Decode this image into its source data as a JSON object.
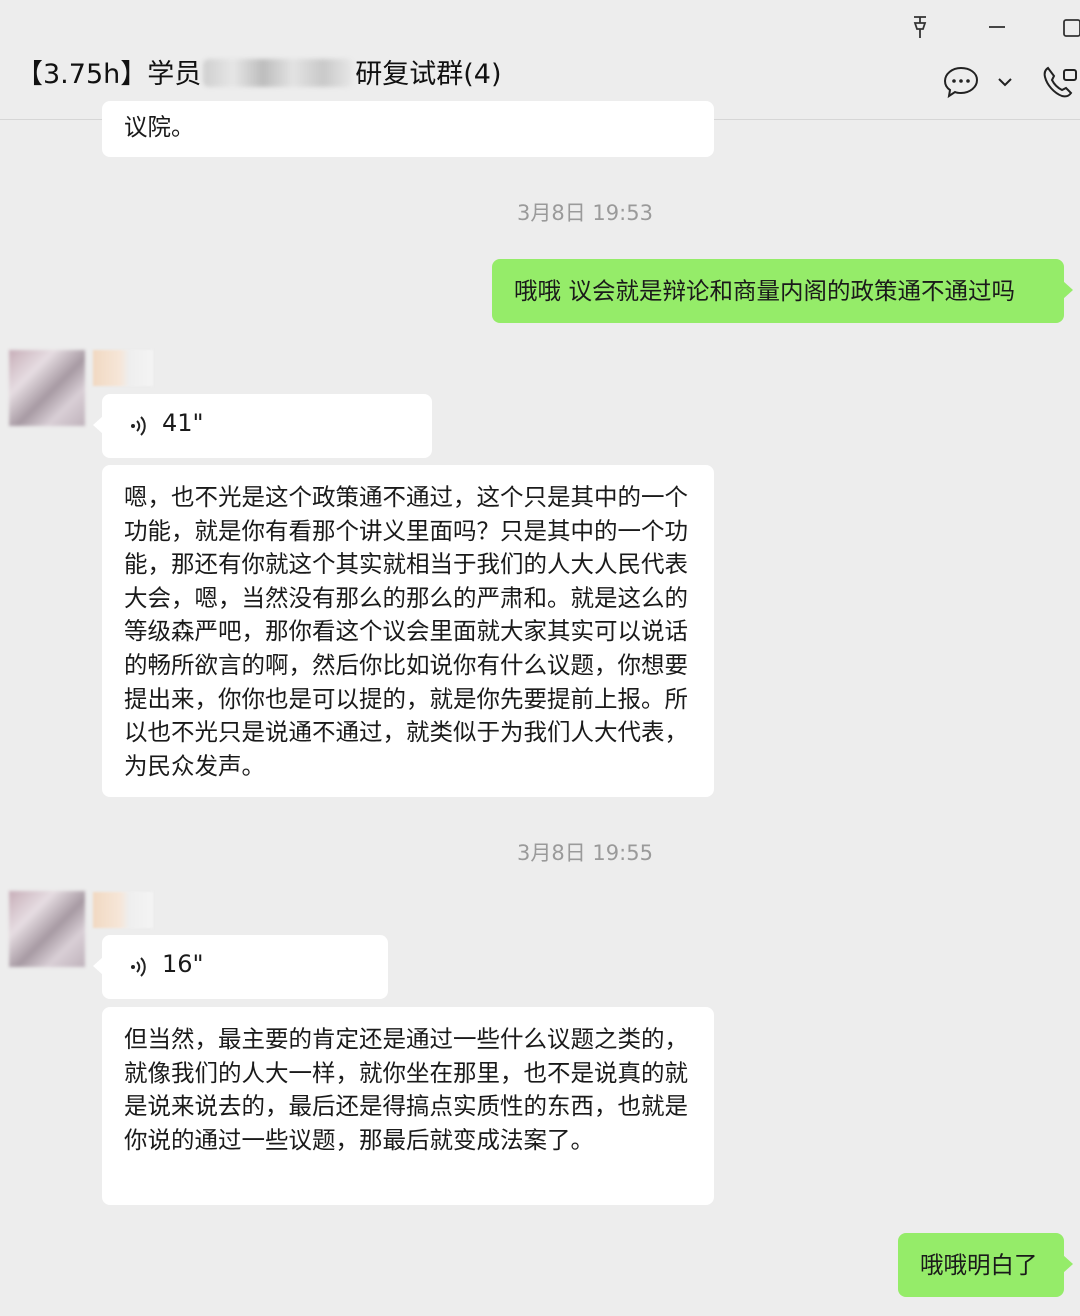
{
  "header": {
    "title_prefix": "【3.75h】学员",
    "title_suffix": "研复试群(4)"
  },
  "messages": {
    "top_partial": "议院。",
    "time1": "3月8日 19:53",
    "sent1": "哦哦 议会就是辩论和商量内阁的政策通不通过吗",
    "voice1_duration": "41\"",
    "reply1": "嗯，也不光是这个政策通不通过，这个只是其中的一个功能，就是你有看那个讲义里面吗？只是其中的一个功能，那还有你就这个其实就相当于我们的人大人民代表大会，嗯，当然没有那么的那么的严肃和。就是这么的等级森严吧，那你看这个议会里面就大家其实可以说话的畅所欲言的啊，然后你比如说你有什么议题，你想要提出来，你你也是可以提的，就是你先要提前上报。所以也不光只是说通不通过，就类似于为我们人大代表，为民众发声。",
    "time2": "3月8日 19:55",
    "voice2_duration": "16\"",
    "reply2": "但当然，最主要的肯定还是通过一些什么议题之类的，就像我们的人大一样，就你坐在那里，也不是说真的就是说来说去的，最后还是得搞点实质性的东西，也就是你说的通过一些议题，那最后就变成法案了。",
    "sent2": "哦哦明白了"
  },
  "icons": [
    "pin-icon",
    "minimize-icon",
    "maximize-icon",
    "chat-bubble-icon",
    "chevron-down-icon",
    "video-call-icon",
    "voice-wave-icon"
  ],
  "colors": {
    "background": "#ededed",
    "sent_bubble": "#95ec69",
    "received_bubble": "#ffffff",
    "timestamp": "#9a9a9a"
  }
}
